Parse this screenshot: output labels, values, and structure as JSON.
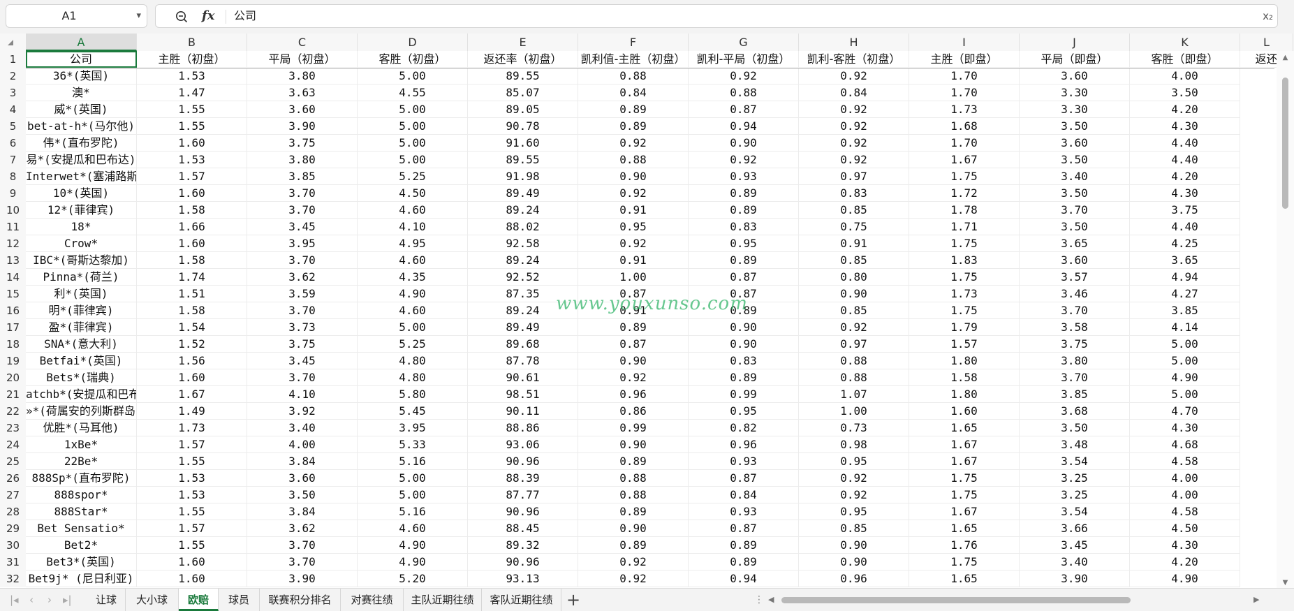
{
  "formula_bar": {
    "name_box": "A1",
    "formula": "公司",
    "fx_label": "fx",
    "zoom_icon": "zoom-out-icon",
    "right_icon": "formula-symbol-icon",
    "right_glyph": "x₂"
  },
  "columns": [
    "A",
    "B",
    "C",
    "D",
    "E",
    "F",
    "G",
    "H",
    "I",
    "J",
    "K",
    "L"
  ],
  "selected_cell": "A1",
  "row_numbers": [
    "1",
    "2",
    "3",
    "4",
    "5",
    "6",
    "7",
    "8",
    "9",
    "10",
    "11",
    "12",
    "13",
    "14",
    "15",
    "16",
    "17",
    "18",
    "19",
    "20",
    "21",
    "22",
    "23",
    "24",
    "25",
    "26",
    "27",
    "28",
    "29",
    "30",
    "31",
    "32"
  ],
  "header_row": [
    "公司",
    "主胜（初盘）",
    "平局（初盘）",
    "客胜（初盘）",
    "返还率（初盘）",
    "凯利值-主胜（初盘）",
    "凯利-平局（初盘）",
    "凯利-客胜（初盘）",
    "主胜（即盘）",
    "平局（即盘）",
    "客胜（即盘）",
    "返还"
  ],
  "rows": [
    [
      "36*(英国)",
      "1.53",
      "3.80",
      "5.00",
      "89.55",
      "0.88",
      "0.92",
      "0.92",
      "1.70",
      "3.60",
      "4.00"
    ],
    [
      "澳*",
      "1.47",
      "3.63",
      "4.55",
      "85.07",
      "0.84",
      "0.88",
      "0.84",
      "1.70",
      "3.30",
      "3.50"
    ],
    [
      "威*(英国)",
      "1.55",
      "3.60",
      "5.00",
      "89.05",
      "0.89",
      "0.87",
      "0.92",
      "1.73",
      "3.30",
      "4.20"
    ],
    [
      "bet-at-h*(马尔他)",
      "1.55",
      "3.90",
      "5.00",
      "90.78",
      "0.89",
      "0.94",
      "0.92",
      "1.68",
      "3.50",
      "4.30"
    ],
    [
      "伟*(直布罗陀)",
      "1.60",
      "3.75",
      "5.00",
      "91.60",
      "0.92",
      "0.90",
      "0.92",
      "1.70",
      "3.60",
      "4.40"
    ],
    [
      "易*(安提瓜和巴布达)",
      "1.53",
      "3.80",
      "5.00",
      "89.55",
      "0.88",
      "0.92",
      "0.92",
      "1.67",
      "3.50",
      "4.40"
    ],
    [
      "Interwet*(塞浦路斯)",
      "1.57",
      "3.85",
      "5.25",
      "91.98",
      "0.90",
      "0.93",
      "0.97",
      "1.75",
      "3.40",
      "4.20"
    ],
    [
      "10*(英国)",
      "1.60",
      "3.70",
      "4.50",
      "89.49",
      "0.92",
      "0.89",
      "0.83",
      "1.72",
      "3.50",
      "4.30"
    ],
    [
      "12*(菲律宾)",
      "1.58",
      "3.70",
      "4.60",
      "89.24",
      "0.91",
      "0.89",
      "0.85",
      "1.78",
      "3.70",
      "3.75"
    ],
    [
      "18*",
      "1.66",
      "3.45",
      "4.10",
      "88.02",
      "0.95",
      "0.83",
      "0.75",
      "1.71",
      "3.50",
      "4.40"
    ],
    [
      "Crow*",
      "1.60",
      "3.95",
      "4.95",
      "92.58",
      "0.92",
      "0.95",
      "0.91",
      "1.75",
      "3.65",
      "4.25"
    ],
    [
      "IBC*(哥斯达黎加)",
      "1.58",
      "3.70",
      "4.60",
      "89.24",
      "0.91",
      "0.89",
      "0.85",
      "1.83",
      "3.60",
      "3.65"
    ],
    [
      "Pinna*(荷兰)",
      "1.74",
      "3.62",
      "4.35",
      "92.52",
      "1.00",
      "0.87",
      "0.80",
      "1.75",
      "3.57",
      "4.94"
    ],
    [
      "利*(英国)",
      "1.51",
      "3.59",
      "4.90",
      "87.35",
      "0.87",
      "0.87",
      "0.90",
      "1.73",
      "3.46",
      "4.27"
    ],
    [
      "明*(菲律宾)",
      "1.58",
      "3.70",
      "4.60",
      "89.24",
      "0.91",
      "0.89",
      "0.85",
      "1.75",
      "3.70",
      "3.85"
    ],
    [
      "盈*(菲律宾)",
      "1.54",
      "3.73",
      "5.00",
      "89.49",
      "0.89",
      "0.90",
      "0.92",
      "1.79",
      "3.58",
      "4.14"
    ],
    [
      "SNA*(意大利)",
      "1.52",
      "3.75",
      "5.25",
      "89.68",
      "0.87",
      "0.90",
      "0.97",
      "1.57",
      "3.75",
      "5.00"
    ],
    [
      "Betfai*(英国)",
      "1.56",
      "3.45",
      "4.80",
      "87.78",
      "0.90",
      "0.83",
      "0.88",
      "1.80",
      "3.80",
      "5.00"
    ],
    [
      "Bets*(瑞典)",
      "1.60",
      "3.70",
      "4.80",
      "90.61",
      "0.92",
      "0.89",
      "0.88",
      "1.58",
      "3.70",
      "4.90"
    ],
    [
      "atchb*(安提瓜和巴布达)",
      "1.67",
      "4.10",
      "5.80",
      "98.51",
      "0.96",
      "0.99",
      "1.07",
      "1.80",
      "3.85",
      "5.00"
    ],
    [
      "»*(荷属安的列斯群岛)",
      "1.49",
      "3.92",
      "5.45",
      "90.11",
      "0.86",
      "0.95",
      "1.00",
      "1.60",
      "3.68",
      "4.70"
    ],
    [
      "优胜*(马耳他)",
      "1.73",
      "3.40",
      "3.95",
      "88.86",
      "0.99",
      "0.82",
      "0.73",
      "1.65",
      "3.50",
      "4.30"
    ],
    [
      "1xBe*",
      "1.57",
      "4.00",
      "5.33",
      "93.06",
      "0.90",
      "0.96",
      "0.98",
      "1.67",
      "3.48",
      "4.68"
    ],
    [
      "22Be*",
      "1.55",
      "3.84",
      "5.16",
      "90.96",
      "0.89",
      "0.93",
      "0.95",
      "1.67",
      "3.54",
      "4.58"
    ],
    [
      "888Sp*(直布罗陀)",
      "1.53",
      "3.60",
      "5.00",
      "88.39",
      "0.88",
      "0.87",
      "0.92",
      "1.75",
      "3.25",
      "4.00"
    ],
    [
      "888spor*",
      "1.53",
      "3.50",
      "5.00",
      "87.77",
      "0.88",
      "0.84",
      "0.92",
      "1.75",
      "3.25",
      "4.00"
    ],
    [
      "888Star*",
      "1.55",
      "3.84",
      "5.16",
      "90.96",
      "0.89",
      "0.93",
      "0.95",
      "1.67",
      "3.54",
      "4.58"
    ],
    [
      "Bet Sensatio*",
      "1.57",
      "3.62",
      "4.60",
      "88.45",
      "0.90",
      "0.87",
      "0.85",
      "1.65",
      "3.66",
      "4.50"
    ],
    [
      "Bet2*",
      "1.55",
      "3.70",
      "4.90",
      "89.32",
      "0.89",
      "0.89",
      "0.90",
      "1.76",
      "3.45",
      "4.30"
    ],
    [
      "Bet3*(英国)",
      "1.60",
      "3.70",
      "4.90",
      "90.96",
      "0.92",
      "0.89",
      "0.90",
      "1.75",
      "3.40",
      "4.20"
    ],
    [
      "Bet9j* (尼日利亚)",
      "1.60",
      "3.90",
      "5.20",
      "93.13",
      "0.92",
      "0.94",
      "0.96",
      "1.65",
      "3.90",
      "4.90"
    ]
  ],
  "watermark": "www.youxunso.com",
  "sheet_tabs": [
    "让球",
    "大小球",
    "欧赔",
    "球员",
    "联赛积分排名",
    "对赛往绩",
    "主队近期往绩",
    "客队近期往绩"
  ],
  "active_tab": "欧赔",
  "add_tab_label": "+",
  "colors": {
    "accent": "#1a7a3c",
    "watermark": "#34b56a"
  }
}
